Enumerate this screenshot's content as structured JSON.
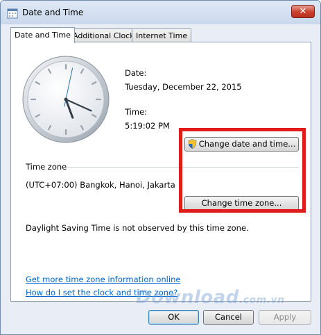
{
  "window": {
    "title": "Date and Time"
  },
  "tabs": [
    {
      "label": "Date and Time",
      "active": true
    },
    {
      "label": "Additional Clocks",
      "active": false
    },
    {
      "label": "Internet Time",
      "active": false
    }
  ],
  "date": {
    "label": "Date:",
    "value": "Tuesday, December 22, 2015"
  },
  "time": {
    "label": "Time:",
    "value": "5:19:02 PM"
  },
  "buttons": {
    "change_date_time": "Change date and time...",
    "change_time_zone": "Change time zone...",
    "ok": "OK",
    "cancel": "Cancel",
    "apply": "Apply"
  },
  "timezone": {
    "heading": "Time zone",
    "value": "(UTC+07:00) Bangkok, Hanoi, Jakarta"
  },
  "dst_note": "Daylight Saving Time is not observed by this time zone.",
  "links": {
    "more_info": "Get more time zone information online",
    "how_to": "How do I set the clock and time zone?"
  },
  "watermark": {
    "main": "Download",
    "suffix": ".com.vn"
  },
  "clock": {
    "hours": 5,
    "minutes": 19,
    "seconds": 2
  },
  "colors": {
    "highlight": "#e01b1b",
    "link": "#0066cc"
  }
}
